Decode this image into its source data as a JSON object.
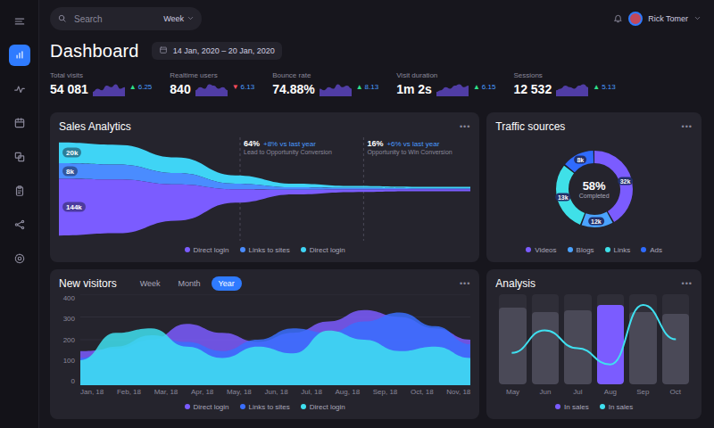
{
  "header": {
    "search": {
      "placeholder": "Search"
    },
    "period": "Week",
    "title": "Dashboard",
    "date": "14 Jan, 2020 – 20 Jan, 2020",
    "user": "Rick Tomer"
  },
  "sidebar": {
    "items": [
      {
        "selected": true
      },
      {
        "selected": false
      },
      {
        "selected": false
      },
      {
        "selected": false
      },
      {
        "selected": false
      },
      {
        "selected": false
      },
      {
        "selected": false
      }
    ]
  },
  "stats": [
    {
      "label": "Total visits",
      "value": "54 081",
      "arrow": "▲",
      "change": "6.25",
      "up": true,
      "spark": [
        3,
        5,
        4,
        7,
        6,
        8,
        5,
        6
      ]
    },
    {
      "label": "Realtime users",
      "value": "840",
      "arrow": "▼",
      "change": "6.13",
      "up": false,
      "spark": [
        4,
        6,
        5,
        8,
        7,
        5,
        6,
        4
      ]
    },
    {
      "label": "Bounce rate",
      "value": "74.88%",
      "arrow": "▲",
      "change": "8.13",
      "up": true,
      "spark": [
        5,
        4,
        6,
        5,
        8,
        6,
        7,
        5
      ]
    },
    {
      "label": "Visit duration",
      "value": "1m 2s",
      "arrow": "▲",
      "change": "6.15",
      "up": true,
      "spark": [
        3,
        4,
        6,
        5,
        7,
        8,
        6,
        7
      ]
    },
    {
      "label": "Sessions",
      "value": "12 532",
      "arrow": "▲",
      "change": "5.13",
      "up": true,
      "spark": [
        4,
        5,
        7,
        6,
        5,
        7,
        8,
        6
      ]
    }
  ],
  "sales": {
    "title": "Sales Analytics",
    "menu": "•••",
    "series": [
      {
        "name": "Direct login",
        "label": "144k",
        "color": "#7b5cff",
        "values": [
          110,
          104,
          70,
          26,
          9,
          5,
          4,
          4
        ]
      },
      {
        "name": "Links to sites",
        "label": "8k",
        "color": "#4a8cff",
        "values": [
          30,
          29,
          22,
          11,
          5,
          3,
          2,
          2
        ]
      },
      {
        "name": "Direct login",
        "label": "20k",
        "color": "#3fd4f5",
        "values": [
          40,
          38,
          30,
          16,
          7,
          4,
          3,
          3
        ]
      }
    ],
    "notes": [
      {
        "value": "64%",
        "delta": "+8% vs last year",
        "caption": "Lead to Opportunity Conversion"
      },
      {
        "value": "16%",
        "delta": "+6% vs last year",
        "caption": "Opportunity to Win Conversion"
      }
    ]
  },
  "traffic": {
    "title": "Traffic sources",
    "menu": "•••",
    "center": "58%",
    "caption": "Completed",
    "segments": [
      {
        "name": "Videos",
        "value": "32k",
        "share": 0.42,
        "color": "#7b5cff"
      },
      {
        "name": "Blogs",
        "value": "12k",
        "share": 0.14,
        "color": "#4aa3ff"
      },
      {
        "name": "Links",
        "value": "13k",
        "share": 0.3,
        "color": "#3fe0e8"
      },
      {
        "name": "Ads",
        "value": "8k",
        "share": 0.14,
        "color": "#2f6bff"
      }
    ]
  },
  "visitors": {
    "title": "New visitors",
    "menu": "•••",
    "tabs": [
      {
        "label": "Week",
        "selected": false
      },
      {
        "label": "Month",
        "selected": false
      },
      {
        "label": "Year",
        "selected": true
      }
    ],
    "y_ticks": [
      "400",
      "300",
      "200",
      "100",
      "0"
    ],
    "x_labels": [
      "Jan, 18",
      "Feb, 18",
      "Mar, 18",
      "Apr, 18",
      "May, 18",
      "Jun, 18",
      "Jul, 18",
      "Aug, 18",
      "Sep, 18",
      "Oct, 18",
      "Nov, 18"
    ],
    "series": [
      {
        "name": "Direct login",
        "color": "#7b5cff",
        "values": [
          150,
          160,
          200,
          270,
          230,
          190,
          230,
          280,
          330,
          300,
          250,
          200
        ]
      },
      {
        "name": "Links to sites",
        "color": "#3a6fff",
        "values": [
          120,
          170,
          220,
          190,
          150,
          200,
          250,
          230,
          280,
          320,
          260,
          180
        ]
      },
      {
        "name": "Direct login",
        "color": "#3fe0f0",
        "values": [
          110,
          230,
          250,
          170,
          120,
          170,
          140,
          240,
          200,
          150,
          170,
          120
        ]
      }
    ]
  },
  "analysis": {
    "title": "Analysis",
    "menu": "•••",
    "bars": [
      {
        "label": "May",
        "level": 0.85,
        "selected": false
      },
      {
        "label": "Jun",
        "level": 0.8,
        "selected": false
      },
      {
        "label": "Jul",
        "level": 0.82,
        "selected": false
      },
      {
        "label": "Aug",
        "level": 0.88,
        "selected": true
      },
      {
        "label": "Sep",
        "level": 0.8,
        "selected": false
      },
      {
        "label": "Oct",
        "level": 0.78,
        "selected": false
      }
    ],
    "line": {
      "name": "In sales",
      "color": "#3fe0f0",
      "values": [
        35,
        60,
        40,
        22,
        88,
        50
      ]
    },
    "legend": [
      {
        "name": "In sales",
        "color": "#7b5cff"
      },
      {
        "name": "In sales",
        "color": "#3fe0f0"
      }
    ]
  }
}
